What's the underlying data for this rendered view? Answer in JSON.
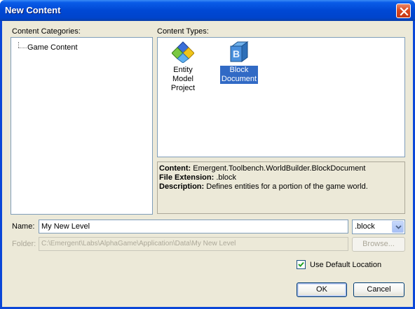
{
  "window": {
    "title": "New Content"
  },
  "categories": {
    "label": "Content Categories:",
    "items": [
      "Game Content"
    ]
  },
  "types": {
    "label": "Content Types:",
    "items": [
      {
        "label_line1": "Entity Model",
        "label_line2": "Project",
        "icon": "entity-model-icon",
        "selected": false
      },
      {
        "label_line1": "Block",
        "label_line2": "Document",
        "icon": "block-document-icon",
        "selected": true
      }
    ]
  },
  "info": {
    "content_label": "Content",
    "content_value": "Emergent.Toolbench.WorldBuilder.BlockDocument",
    "ext_label": "File Extension",
    "ext_value": ".block",
    "desc_label": "Description",
    "desc_value": "Defines entities for a portion of the game world."
  },
  "name": {
    "label": "Name:",
    "value": "My New Level",
    "extension": ".block"
  },
  "folder": {
    "label": "Folder:",
    "value": "C:\\Emergent\\Labs\\AlphaGame\\Application\\Data\\My New Level",
    "browse_label": "Browse..."
  },
  "use_default_location": {
    "label": "Use Default Location",
    "checked": true
  },
  "buttons": {
    "ok": "OK",
    "cancel": "Cancel"
  },
  "colors": {
    "selection": "#316ac5",
    "titlebar": "#0048d4",
    "dialog_bg": "#ece9d8"
  }
}
